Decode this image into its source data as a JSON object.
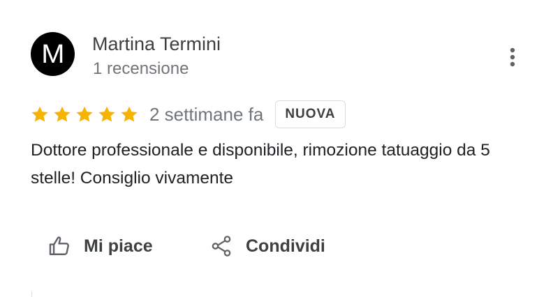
{
  "review": {
    "avatar_letter": "M",
    "author_name": "Martina Termini",
    "author_meta": "1 recensione",
    "rating": 5,
    "rating_max": 5,
    "date": "2 settimane fa",
    "badge": "NUOVA",
    "text": "Dottore professionale e disponibile, rimozione tatuaggio da 5 stelle! Consiglio vivamente"
  },
  "actions": {
    "like_label": "Mi piace",
    "share_label": "Condividi"
  },
  "icons": {
    "more": "more-vert-icon",
    "star": "star-icon",
    "like": "thumb-up-icon",
    "share": "share-icon"
  },
  "colors": {
    "star": "#f4b400",
    "text_primary": "#202124",
    "text_secondary": "#70757a",
    "badge_border": "#dadce0"
  }
}
